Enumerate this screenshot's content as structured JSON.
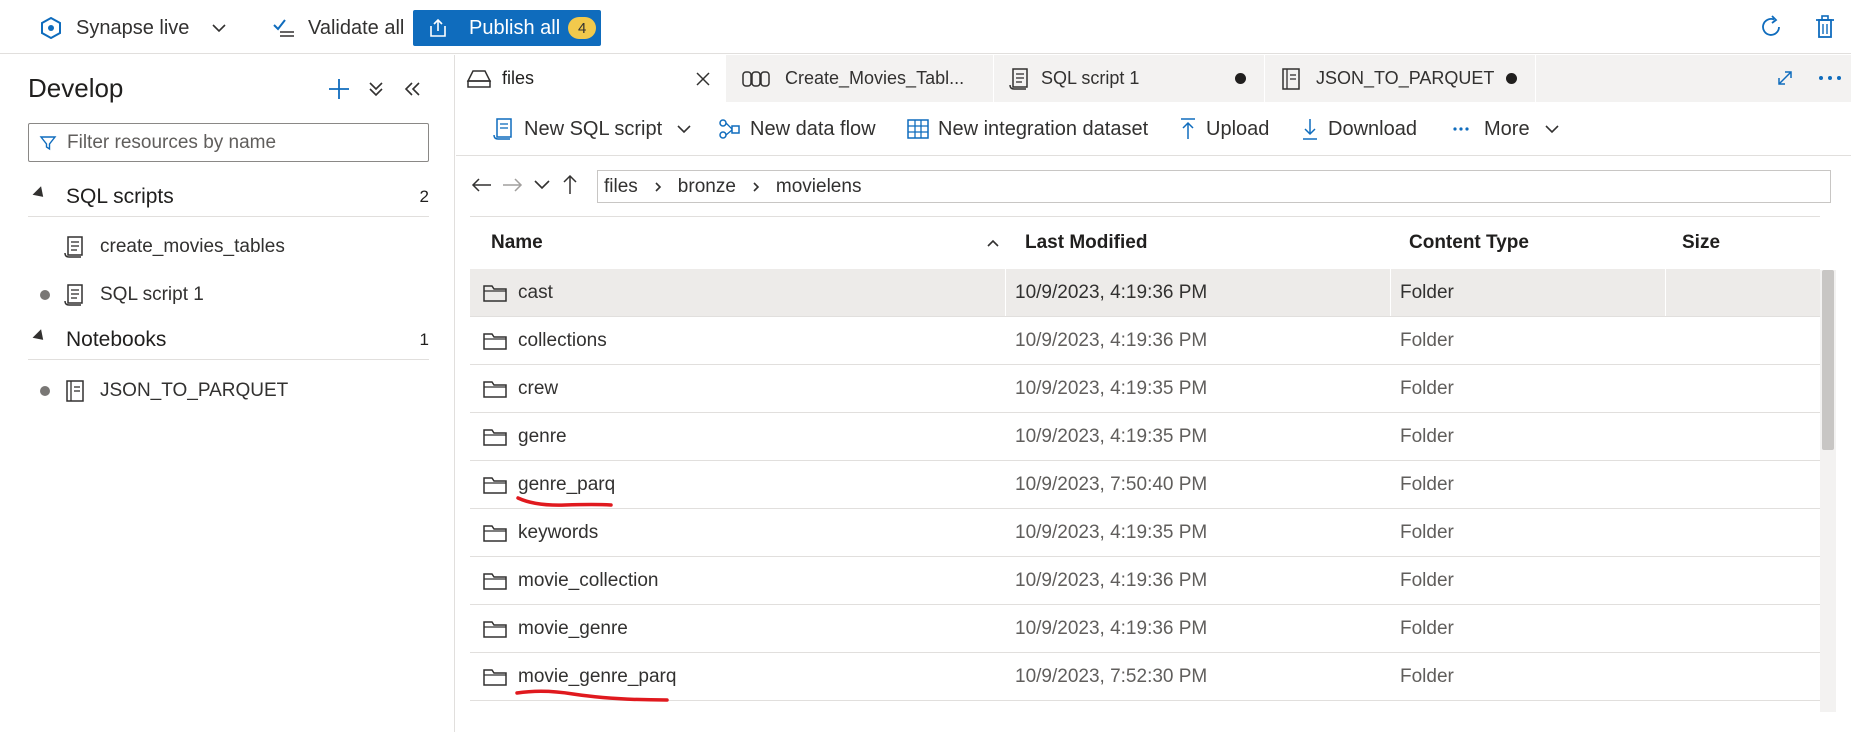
{
  "topbar": {
    "workspace": "Synapse live",
    "validate_all": "Validate all",
    "publish_all": "Publish all",
    "publish_badge": "4"
  },
  "develop": {
    "title": "Develop",
    "filter_placeholder": "Filter resources by name",
    "sections": [
      {
        "label": "SQL scripts",
        "count": "2",
        "items": [
          "create_movies_tables",
          "SQL script 1"
        ]
      },
      {
        "label": "Notebooks",
        "count": "1",
        "items": [
          "JSON_TO_PARQUET"
        ]
      }
    ]
  },
  "tabs": [
    {
      "label": "files",
      "active": true,
      "icon": "storage-icon"
    },
    {
      "label": "Create_Movies_Tabl...",
      "active": false,
      "icon": "pipeline-icon"
    },
    {
      "label": "SQL script 1",
      "active": false,
      "icon": "script-icon",
      "unsaved": true
    },
    {
      "label": "JSON_TO_PARQUET",
      "active": false,
      "icon": "notebook-icon",
      "unsaved": true
    }
  ],
  "toolbar": {
    "new_sql_script": "New SQL script",
    "new_data_flow": "New data flow",
    "new_integration_dataset": "New integration dataset",
    "upload": "Upload",
    "download": "Download",
    "more": "More"
  },
  "breadcrumb": [
    "files",
    "bronze",
    "movielens"
  ],
  "table": {
    "columns": [
      "Name",
      "Last Modified",
      "Content Type",
      "Size"
    ],
    "rows": [
      {
        "name": "cast",
        "modified": "10/9/2023, 4:19:36 PM",
        "type": "Folder",
        "selected": true
      },
      {
        "name": "collections",
        "modified": "10/9/2023, 4:19:36 PM",
        "type": "Folder"
      },
      {
        "name": "crew",
        "modified": "10/9/2023, 4:19:35 PM",
        "type": "Folder"
      },
      {
        "name": "genre",
        "modified": "10/9/2023, 4:19:35 PM",
        "type": "Folder"
      },
      {
        "name": "genre_parq",
        "modified": "10/9/2023, 7:50:40 PM",
        "type": "Folder",
        "highlighted": true
      },
      {
        "name": "keywords",
        "modified": "10/9/2023, 4:19:35 PM",
        "type": "Folder"
      },
      {
        "name": "movie_collection",
        "modified": "10/9/2023, 4:19:36 PM",
        "type": "Folder"
      },
      {
        "name": "movie_genre",
        "modified": "10/9/2023, 4:19:36 PM",
        "type": "Folder"
      },
      {
        "name": "movie_genre_parq",
        "modified": "10/9/2023, 7:52:30 PM",
        "type": "Folder",
        "highlighted": true
      }
    ]
  },
  "colors": {
    "accent": "#0f6cbd",
    "badge": "#f2c94c",
    "annotation": "#e0191e"
  }
}
